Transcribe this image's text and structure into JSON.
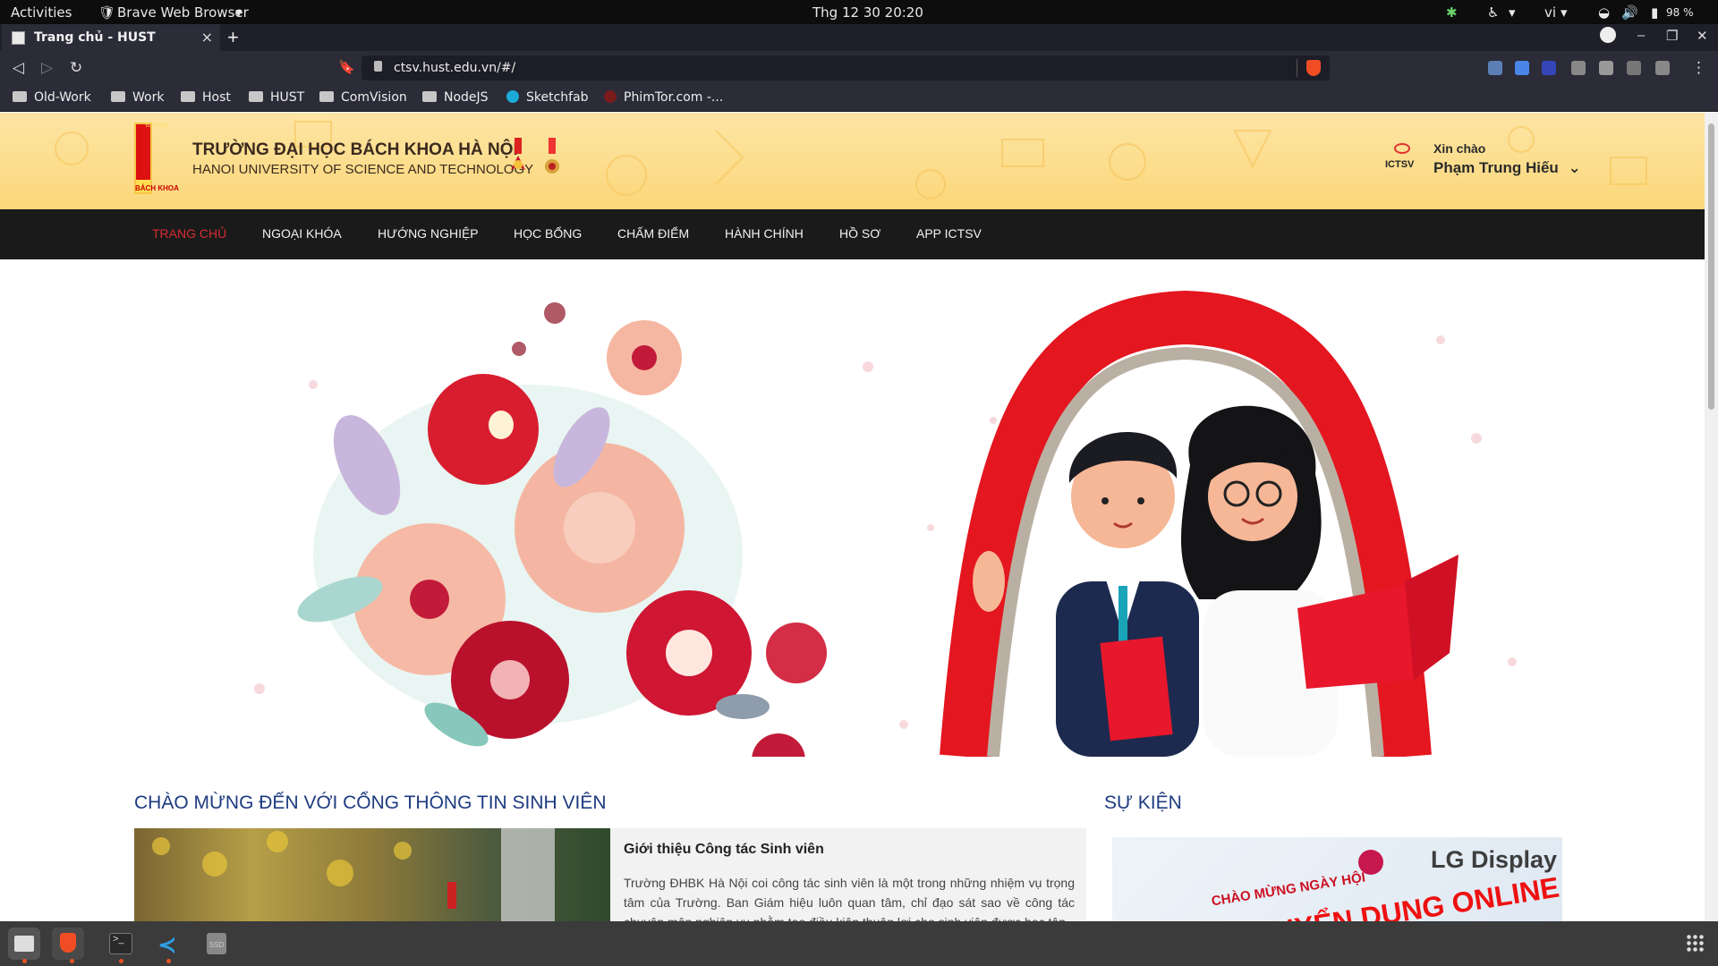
{
  "os_bar": {
    "activities": "Activities",
    "app_name": "Brave Web Browser",
    "app_arrow": "▾",
    "clock": "Thg 12 30  20:20",
    "lang": "vi",
    "lang_arrow": "▾",
    "battery": "98 %"
  },
  "browser": {
    "tab_title": "Trang chủ - HUST",
    "tab_close": "×",
    "new_tab": "+",
    "url": "ctsv.hust.edu.vn/#/",
    "bookmarks": [
      {
        "label": "Old-Work"
      },
      {
        "label": "Work"
      },
      {
        "label": "Host"
      },
      {
        "label": "HUST"
      },
      {
        "label": "ComVision"
      },
      {
        "label": "NodeJS"
      },
      {
        "label": "Sketchfab"
      },
      {
        "label": "PhimTor.com -..."
      }
    ]
  },
  "site": {
    "uni_name_vn": "TRƯỜNG ĐẠI HỌC BÁCH KHOA HÀ NỘI",
    "uni_name_en": "HANOI UNIVERSITY OF SCIENCE AND TECHNOLOGY",
    "logo_text_top": "ĐẠI HỌC",
    "logo_text_bottom": "BÁCH KHOA",
    "ictsv_label": "ICTSV",
    "greeting": "Xin chào",
    "user_name": "Phạm Trung Hiếu",
    "user_arrow": "⌄",
    "menu": [
      {
        "label": "TRANG CHỦ",
        "active": true
      },
      {
        "label": "NGOẠI KHÓA"
      },
      {
        "label": "HƯỚNG NGHIỆP"
      },
      {
        "label": "HỌC BỔNG"
      },
      {
        "label": "CHẤM ĐIỂM"
      },
      {
        "label": "HÀNH CHÍNH"
      },
      {
        "label": "HỒ SƠ"
      },
      {
        "label": "APP ICTSV"
      }
    ],
    "welcome_title": "CHÀO MỪNG ĐẾN VỚI CỔNG THÔNG TIN SINH VIÊN",
    "events_title": "SỰ KIỆN",
    "intro": {
      "heading": "Giới thiệu Công tác Sinh viên",
      "text": "Trường ĐHBK Hà Nội coi công tác sinh viên là một trong những nhiệm vụ trọng tâm của Trường. Ban Giám hiệu luôn quan tâm, chỉ đạo sát sao về công tác chuyên môn nghiệp vụ nhằm tạo điều kiện thuận lợi cho sinh viên được học tập"
    },
    "event_banner": {
      "brand": "LG Display",
      "line1": "CHÀO MỪNG NGÀY HỘI",
      "line2": "TUYỂN DỤNG ONLINE"
    }
  },
  "colors": {
    "menu_active": "#d82c32",
    "header_bg": "#fbd77a",
    "title_blue": "#1d3b80"
  },
  "taskbar": {
    "apps": [
      "files-icon",
      "brave-icon",
      "terminal-icon",
      "vscode-icon",
      "ssd-icon"
    ],
    "ssd_label": "SSD"
  }
}
